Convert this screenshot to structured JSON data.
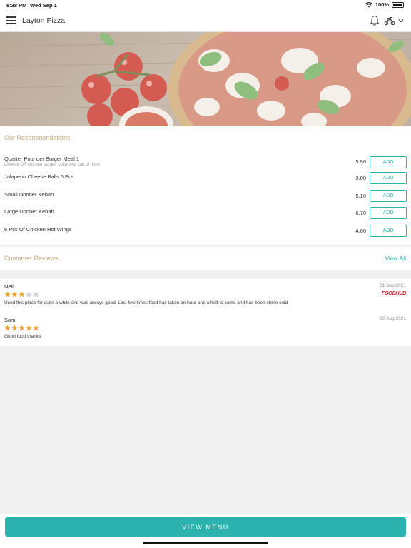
{
  "status_bar": {
    "time": "8:38 PM",
    "date": "Wed Sep 1",
    "battery": "100%"
  },
  "nav": {
    "title": "Layton Pizza"
  },
  "recommendations": {
    "title": "Our Recommendations",
    "items": [
      {
        "name": "Quarter Pounder Burger Meal 1",
        "description": "Cheese OR chicken burger, chips and can of drink",
        "price": "5.90",
        "button": "ADD"
      },
      {
        "name": "Jalapeno Cheese Balls 5 Pcs",
        "description": "",
        "price": "3.80",
        "button": "ADD"
      },
      {
        "name": "Small Donner Kebab",
        "description": "",
        "price": "5.10",
        "button": "ADD"
      },
      {
        "name": "Large Donner Kebab",
        "description": "",
        "price": "6.70",
        "button": "ADD"
      },
      {
        "name": "6 Pcs Of Chicken Hot Wings",
        "description": "",
        "price": "4.00",
        "button": "ADD"
      }
    ]
  },
  "reviews": {
    "title": "Customer Reviews",
    "view_all": "View All",
    "items": [
      {
        "name": "Neil",
        "date": "01 Sep 2021",
        "rating": 3,
        "max_rating": 5,
        "text": "Used this place for quite a while and was always good. Last few times food has taken an hour and a half to come and has been stone cold",
        "source": "FOODHUB"
      },
      {
        "name": "Sam",
        "date": "30 Aug 2021",
        "rating": 5,
        "max_rating": 5,
        "text": "Good food thanks",
        "source": ""
      }
    ]
  },
  "footer": {
    "view_menu": "VIEW MENU"
  },
  "colors": {
    "accent": "#2bb3b0",
    "section_title": "#c5a57a",
    "star_filled": "#f0a030",
    "star_empty": "#cfcfcf",
    "foodhub": "#d9232d"
  }
}
